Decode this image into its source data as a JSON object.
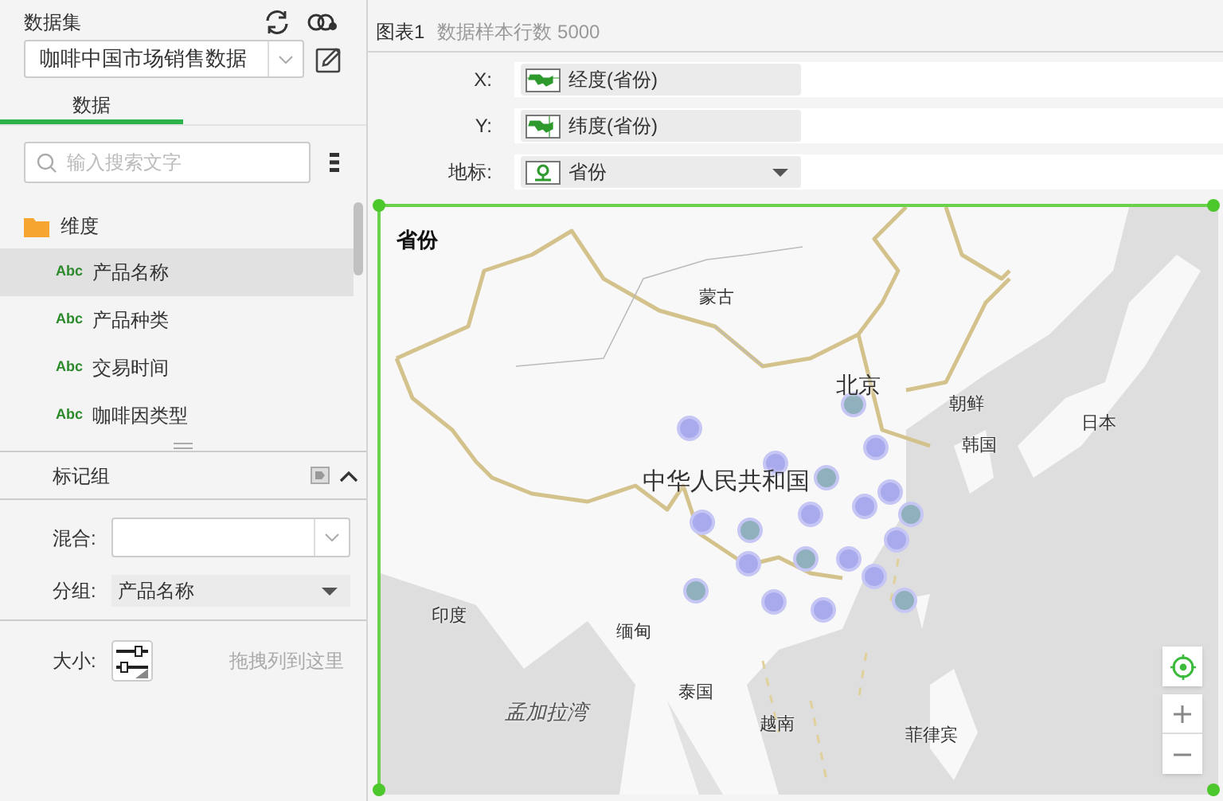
{
  "dataset": {
    "label": "数据集",
    "value": "咖啡中国市场销售数据"
  },
  "tabs": [
    {
      "label": "数据",
      "selected": true
    }
  ],
  "search": {
    "placeholder": "输入搜索文字"
  },
  "tree": [
    {
      "label": "维度",
      "expanded": true,
      "children": [
        {
          "badge": "Abc",
          "label": "产品名称",
          "selected": true
        },
        {
          "badge": "Abc",
          "label": "产品种类",
          "selected": false
        },
        {
          "badge": "Abc",
          "label": "交易时间",
          "selected": false
        },
        {
          "badge": "Abc",
          "label": "咖啡因类型",
          "selected": false
        }
      ]
    }
  ],
  "marks_panel": {
    "title": "标记组",
    "expanded": true,
    "fields": [
      {
        "kind": "combo",
        "label": "混合:"
      },
      {
        "kind": "select",
        "label": "分组:",
        "value": "产品名称"
      },
      {
        "kind": "drop",
        "label": "大小:",
        "hint": "拖拽列到这里"
      }
    ]
  },
  "chart": {
    "title": "图表1",
    "sample": "数据样本行数 5000",
    "bindings": [
      {
        "kind": "longitude",
        "label": "X:",
        "value": "经度(省份)"
      },
      {
        "kind": "latitude",
        "label": "Y:",
        "value": "纬度(省份)"
      },
      {
        "kind": "geo",
        "label": "地标:",
        "value": "省份"
      }
    ],
    "map": {
      "title": "省份",
      "labels": [
        {
          "kind": "region",
          "text": "蒙古"
        },
        {
          "kind": "capital",
          "text": "北京"
        },
        {
          "kind": "region",
          "text": "朝鲜"
        },
        {
          "kind": "region",
          "text": "日本"
        },
        {
          "kind": "region",
          "text": "韩国"
        },
        {
          "kind": "country",
          "text": "中华人民共和国"
        },
        {
          "kind": "region",
          "text": "印度"
        },
        {
          "kind": "region",
          "text": "缅甸"
        },
        {
          "kind": "sea",
          "text": "孟加拉湾"
        },
        {
          "kind": "region",
          "text": "泰国"
        },
        {
          "kind": "region",
          "text": "越南"
        },
        {
          "kind": "region",
          "text": "菲律宾"
        }
      ]
    }
  }
}
